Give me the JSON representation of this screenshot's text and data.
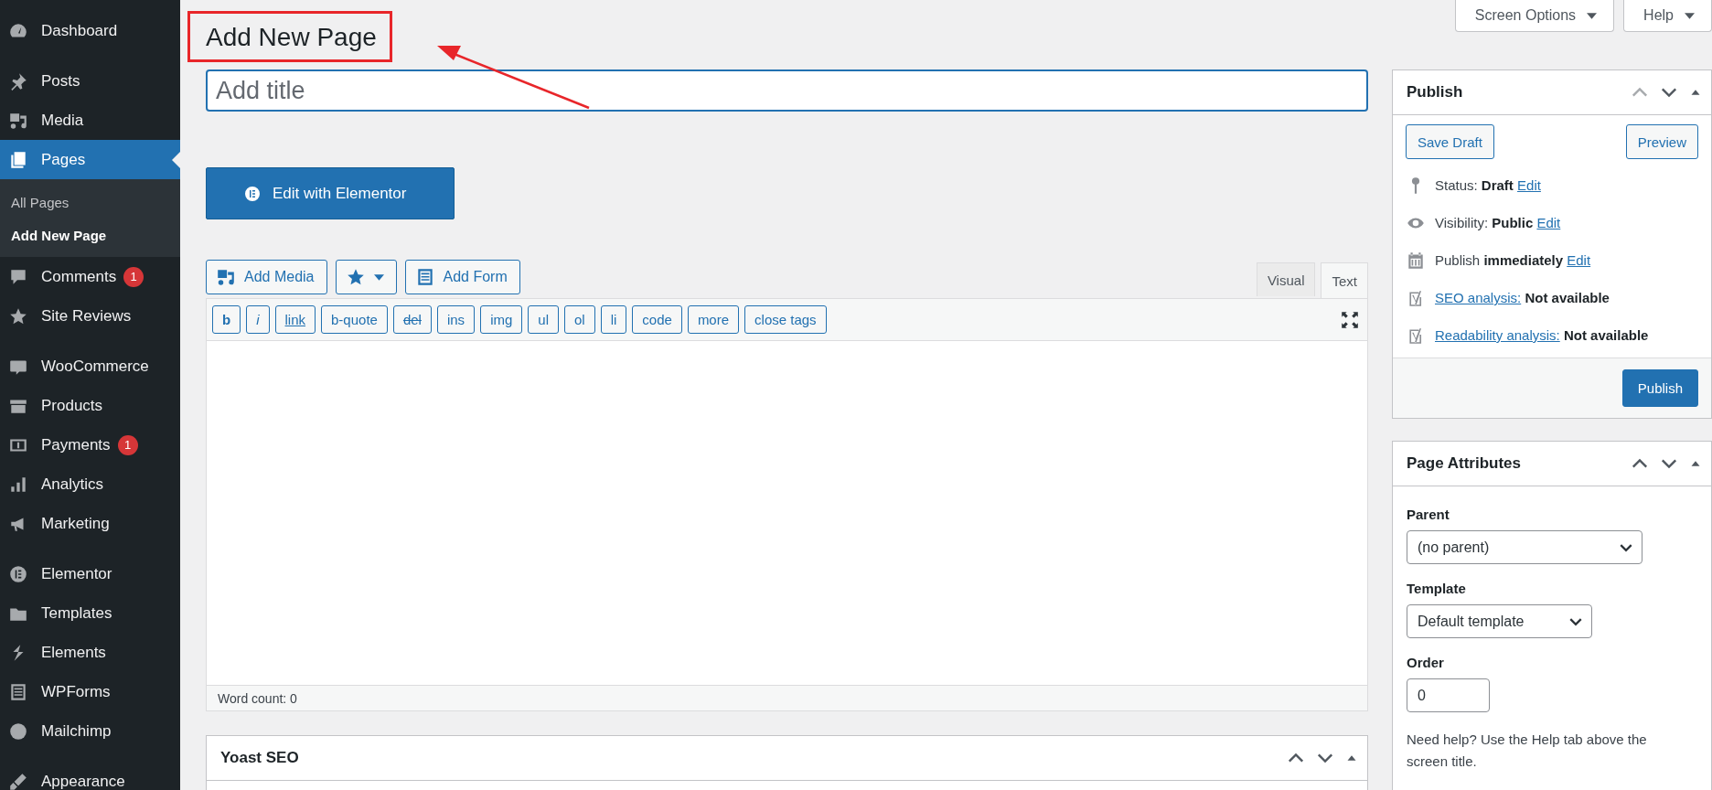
{
  "sidebar": {
    "groups": [
      {
        "items": [
          {
            "label": "Dashboard",
            "kind": "dashboard",
            "selected": false
          }
        ]
      },
      {
        "items": [
          {
            "label": "Posts",
            "kind": "posts",
            "selected": false
          },
          {
            "label": "Media",
            "kind": "media",
            "selected": false
          },
          {
            "label": "Pages",
            "kind": "pages",
            "selected": true,
            "children": [
              {
                "label": "All Pages",
                "selected": false
              },
              {
                "label": "Add New Page",
                "selected": true
              }
            ]
          },
          {
            "label": "Comments",
            "kind": "comments",
            "selected": false,
            "badge": "1"
          },
          {
            "label": "Site Reviews",
            "kind": "star",
            "selected": false
          }
        ]
      },
      {
        "items": [
          {
            "label": "WooCommerce",
            "kind": "woo",
            "selected": false
          },
          {
            "label": "Products",
            "kind": "products",
            "selected": false
          },
          {
            "label": "Payments",
            "kind": "payments",
            "selected": false,
            "badge": "1"
          },
          {
            "label": "Analytics",
            "kind": "analytics",
            "selected": false
          },
          {
            "label": "Marketing",
            "kind": "marketing",
            "selected": false
          }
        ]
      },
      {
        "items": [
          {
            "label": "Elementor",
            "kind": "elementor",
            "selected": false
          },
          {
            "label": "Templates",
            "kind": "templates",
            "selected": false
          },
          {
            "label": "Elements",
            "kind": "elements",
            "selected": false
          },
          {
            "label": "WPForms",
            "kind": "wpforms",
            "selected": false
          },
          {
            "label": "Mailchimp",
            "kind": "mailchimp",
            "selected": false
          }
        ]
      },
      {
        "items": [
          {
            "label": "Appearance",
            "kind": "appearance",
            "selected": false
          }
        ]
      }
    ]
  },
  "header_tabs": [
    {
      "label": "Screen Options"
    },
    {
      "label": "Help"
    }
  ],
  "page_title": "Add New Page",
  "callout": {
    "kind": "box-and-arrow"
  },
  "title_field": {
    "placeholder": "Add title"
  },
  "elementor_button": "Edit with Elementor",
  "media_buttons": [
    {
      "kind": "media",
      "label": "Add Media"
    },
    {
      "kind": "star"
    },
    {
      "kind": "form",
      "label": "Add Form"
    }
  ],
  "editor_tabs": [
    {
      "label": "Visual",
      "selected": false
    },
    {
      "label": "Text",
      "selected": true
    }
  ],
  "quicktags": [
    {
      "label": "b",
      "kind": "bold"
    },
    {
      "label": "i",
      "kind": "italic"
    },
    {
      "label": "link",
      "kind": "underline"
    },
    {
      "label": "b-quote",
      "kind": "plain"
    },
    {
      "label": "del",
      "kind": "strike"
    },
    {
      "label": "ins",
      "kind": "plain"
    },
    {
      "label": "img",
      "kind": "plain"
    },
    {
      "label": "ul",
      "kind": "plain"
    },
    {
      "label": "ol",
      "kind": "plain"
    },
    {
      "label": "li",
      "kind": "plain"
    },
    {
      "label": "code",
      "kind": "plain"
    },
    {
      "label": "more",
      "kind": "plain"
    },
    {
      "label": "close tags",
      "kind": "plain"
    }
  ],
  "word_count": "Word count: 0",
  "yoast": {
    "title": "Yoast SEO"
  },
  "publish": {
    "title": "Publish",
    "save_draft": "Save Draft",
    "preview": "Preview",
    "rows": [
      {
        "kind": "status",
        "label": "Status:",
        "value": "Draft",
        "link": "Edit"
      },
      {
        "kind": "visibility",
        "label": "Visibility:",
        "value": "Public",
        "link": "Edit"
      },
      {
        "kind": "schedule",
        "label": "Publish",
        "value": "immediately",
        "link": "Edit"
      },
      {
        "kind": "seo",
        "link": "SEO analysis:",
        "value": "Not available"
      },
      {
        "kind": "readability",
        "link": "Readability analysis:",
        "value": "Not available"
      }
    ],
    "button": "Publish"
  },
  "page_attributes": {
    "title": "Page Attributes",
    "fields": [
      {
        "kind": "select",
        "label": "Parent",
        "value": "(no parent)"
      },
      {
        "kind": "select",
        "label": "Template",
        "value": "Default template"
      },
      {
        "kind": "number",
        "label": "Order",
        "value": "0"
      }
    ],
    "help": "Need help? Use the Help tab above the screen title."
  }
}
